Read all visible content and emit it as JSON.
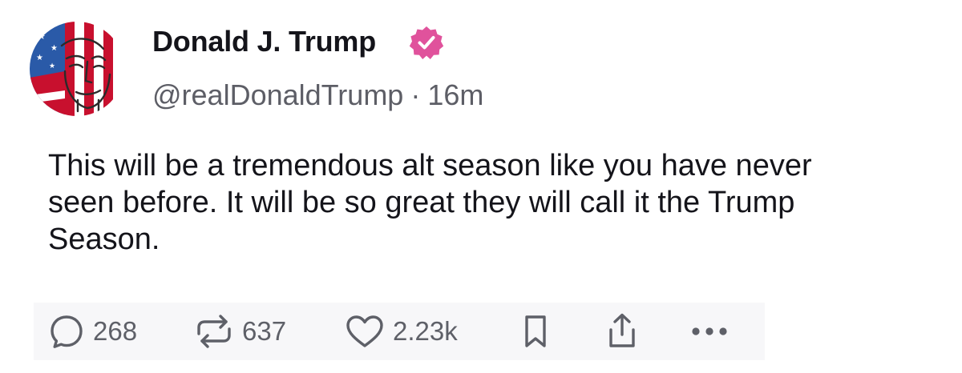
{
  "author": {
    "display_name": "Donald J. Trump",
    "handle": "@realDonaldTrump",
    "separator": "·",
    "time_ago": "16m",
    "verified_badge": "verified-check-icon",
    "badge_color": "#e0529c"
  },
  "post": {
    "text": "This will be a tremendous alt season like you have never seen before. It will be so great they will call it the Trump Season."
  },
  "actions": {
    "replies": {
      "icon": "reply-bubble-icon",
      "count": "268"
    },
    "reposts": {
      "icon": "repost-arrows-icon",
      "count": "637"
    },
    "likes": {
      "icon": "heart-icon",
      "count": "2.23k"
    },
    "bookmark": {
      "icon": "bookmark-icon"
    },
    "share": {
      "icon": "share-upload-icon"
    },
    "more": {
      "icon": "more-dots-icon"
    }
  },
  "colors": {
    "text_primary": "#14141a",
    "text_secondary": "#5d5e66",
    "icon_gray": "#5e6068",
    "flag_red": "#c8102e",
    "flag_blue": "#2a5aa8"
  }
}
